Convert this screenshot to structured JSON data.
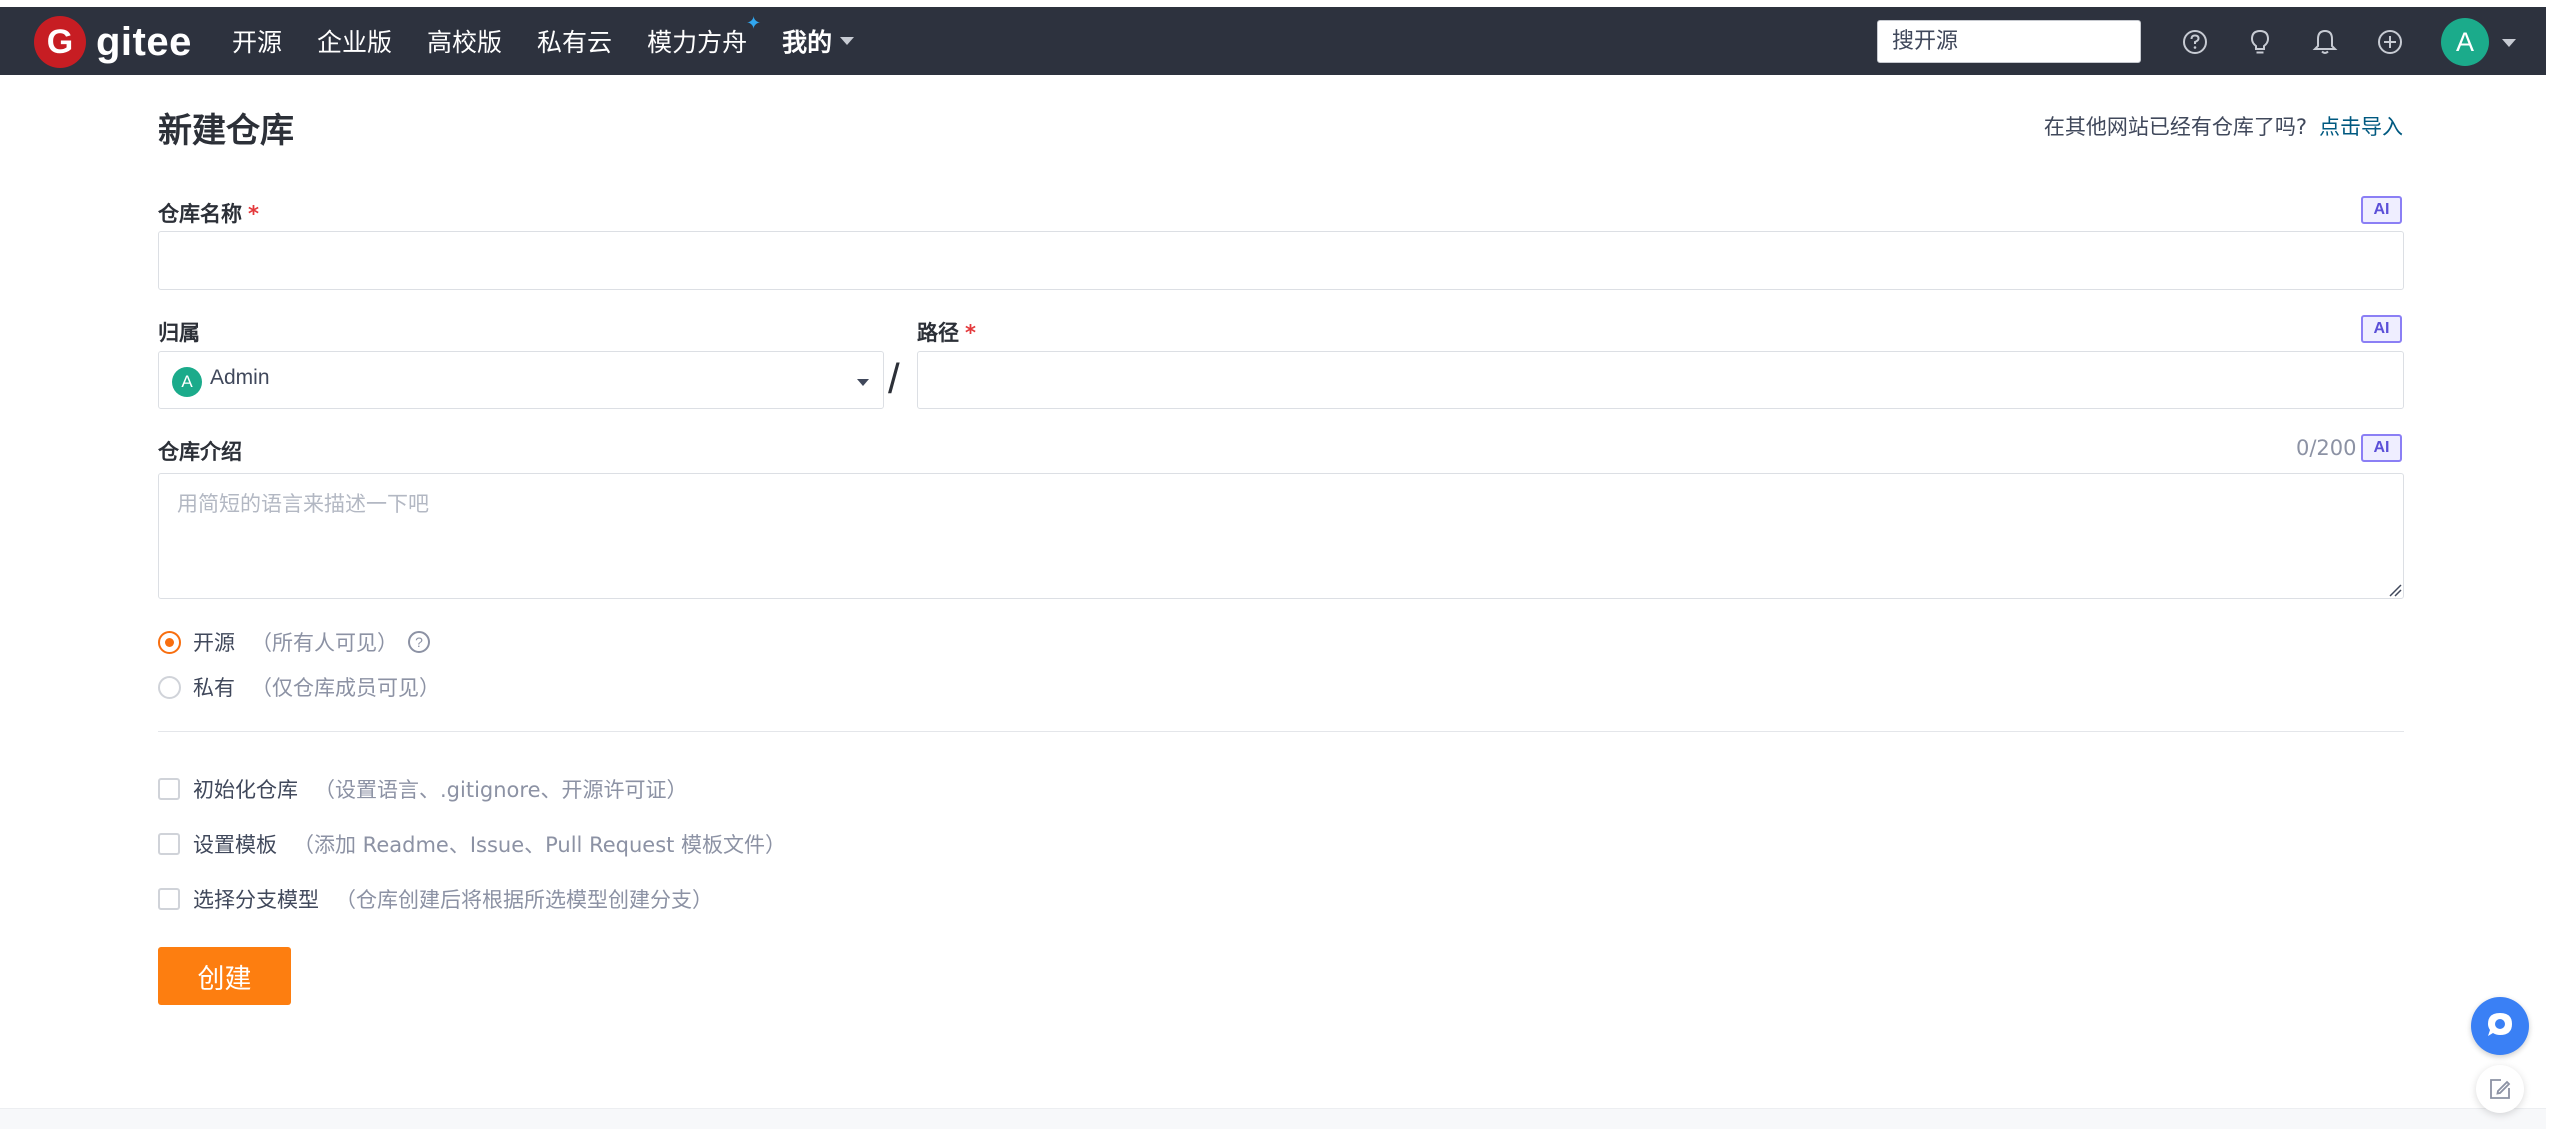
{
  "navbar": {
    "logo_letter": "G",
    "logo_text": "gitee",
    "links": [
      "开源",
      "企业版",
      "高校版",
      "私有云",
      "模力方舟",
      "我的"
    ],
    "search_placeholder": "搜开源",
    "avatar_letter": "A"
  },
  "page": {
    "title": "新建仓库",
    "import_question": "在其他网站已经有仓库了吗?",
    "import_link": "点击导入"
  },
  "form": {
    "repo_name_label": "仓库名称",
    "required_mark": "*",
    "ai_badge": "AI",
    "owner_label": "归属",
    "owner_avatar_letter": "A",
    "owner_value": "Admin",
    "separator": "/",
    "path_label": "路径",
    "intro_label": "仓库介绍",
    "intro_counter": "0/200",
    "intro_placeholder": "用简短的语言来描述一下吧",
    "visibility": [
      {
        "label": "开源",
        "hint": "（所有人可见）",
        "selected": true
      },
      {
        "label": "私有",
        "hint": "（仅仓库成员可见）",
        "selected": false
      }
    ],
    "options": [
      {
        "label": "初始化仓库",
        "hint": "（设置语言、.gitignore、开源许可证）",
        "checked": false
      },
      {
        "label": "设置模板",
        "hint": "（添加 Readme、Issue、Pull Request 模板文件）",
        "checked": false
      },
      {
        "label": "选择分支模型",
        "hint": "（仓库创建后将根据所选模型创建分支）",
        "checked": false
      }
    ],
    "submit_label": "创建"
  },
  "colors": {
    "navbar_bg": "#2d323e",
    "accent_orange": "#fd7e10",
    "link_blue": "#005980",
    "avatar_green": "#1bab8b",
    "ai_purple": "#8b7ff5"
  }
}
